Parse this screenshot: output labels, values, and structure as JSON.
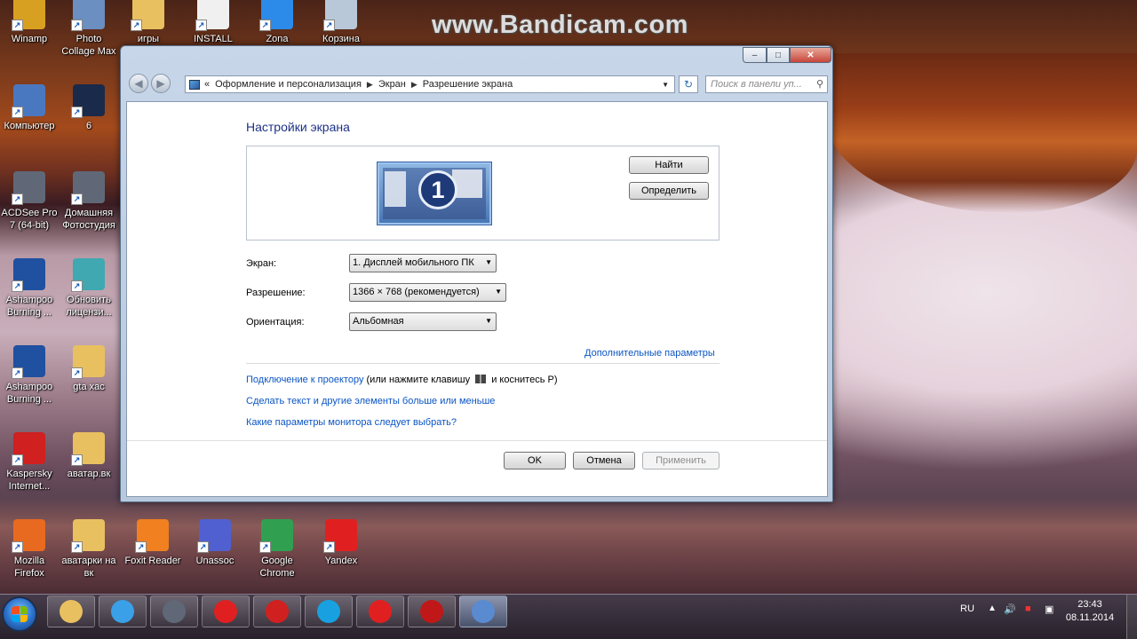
{
  "watermark": "www.Bandicam.com",
  "desktop_icons": [
    {
      "id": "winamp",
      "label": "Winamp",
      "icon": "winamp-icon"
    },
    {
      "id": "photo-collage",
      "label": "Photo\nCollage Max",
      "icon": "photo-collage-icon"
    },
    {
      "id": "igry",
      "label": "игры",
      "icon": "folder-icon"
    },
    {
      "id": "install",
      "label": "INSTALL",
      "icon": "text-file-icon"
    },
    {
      "id": "zona",
      "label": "Zona",
      "icon": "zona-icon"
    },
    {
      "id": "korzina",
      "label": "Корзина",
      "icon": "recycle-bin-icon"
    },
    {
      "id": "kompyuter",
      "label": "Компьютер",
      "icon": "computer-icon"
    },
    {
      "id": "six",
      "label": "6",
      "icon": "media-player-icon"
    },
    {
      "id": "acdsee",
      "label": "ACDSee Pro\n7 (64-bit)",
      "icon": "camera-icon"
    },
    {
      "id": "home-photo",
      "label": "Домашняя\nФотостудия",
      "icon": "camera-icon"
    },
    {
      "id": "ashampoo1",
      "label": "Ashampoo\nBurning ...",
      "icon": "disc-icon"
    },
    {
      "id": "update-license",
      "label": "Обновить\nлицензи...",
      "icon": "license-icon"
    },
    {
      "id": "ashampoo2",
      "label": "Ashampoo\nBurning ...",
      "icon": "disc-icon"
    },
    {
      "id": "gta",
      "label": "gta xac",
      "icon": "folder-icon"
    },
    {
      "id": "kaspersky",
      "label": "Kaspersky\nInternet...",
      "icon": "kaspersky-icon"
    },
    {
      "id": "avatar",
      "label": "аватар.вк",
      "icon": "folder-icon"
    },
    {
      "id": "firefox",
      "label": "Mozilla\nFirefox",
      "icon": "firefox-icon"
    },
    {
      "id": "avatarki",
      "label": "аватарки на\nвк",
      "icon": "folder-icon"
    },
    {
      "id": "foxit",
      "label": "Foxit Reader",
      "icon": "pdf-icon"
    },
    {
      "id": "unassoc",
      "label": "Unassoc",
      "icon": "gear-icon"
    },
    {
      "id": "chrome",
      "label": "Google\nChrome",
      "icon": "chrome-icon"
    },
    {
      "id": "yandex",
      "label": "Yandex",
      "icon": "yandex-icon"
    }
  ],
  "window": {
    "controls": {
      "minimize": "–",
      "maximize": "□",
      "close": "✕"
    },
    "nav": {
      "back": "◀",
      "forward": "▶"
    },
    "address": {
      "prefix": "«",
      "crumbs": [
        "Оформление и персонализация",
        "Экран",
        "Разрешение экрана"
      ],
      "separator": "▶",
      "dropdown": "▼"
    },
    "refresh": "↻",
    "search_placeholder": "Поиск в панели уп...",
    "title": "Настройки экрана",
    "monitor_number": "1",
    "find_button": "Найти",
    "identify_button": "Определить",
    "fields": {
      "screen_label": "Экран:",
      "screen_value": "1. Дисплей мобильного ПК",
      "resolution_label": "Разрешение:",
      "resolution_value": "1366 × 768 (рекомендуется)",
      "orientation_label": "Ориентация:",
      "orientation_value": "Альбомная"
    },
    "advanced_link": "Дополнительные параметры",
    "projector_link": "Подключение к проектору",
    "projector_suffix": "(или нажмите клавишу",
    "projector_suffix2": "и коснитесь P)",
    "text_size_link": "Сделать текст и другие элементы больше или меньше",
    "monitor_settings_link": "Какие параметры монитора следует выбрать?",
    "ok_button": "OK",
    "cancel_button": "Отмена",
    "apply_button": "Применить"
  },
  "taskbar": {
    "language": "RU",
    "time": "23:43",
    "date": "08.11.2014",
    "pinned": [
      "explorer-icon",
      "internet-explorer-icon",
      "camera-icon",
      "yandex-icon",
      "kaspersky-icon",
      "skype-icon",
      "yandex-icon",
      "bandicam-record-icon",
      "display-settings-icon"
    ]
  }
}
